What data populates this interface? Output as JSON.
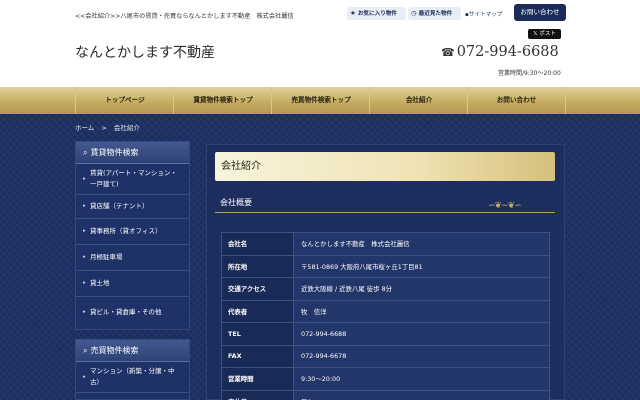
{
  "header": {
    "top_breadcrumb": "<<会社紹介>>八尾市の賃貸・売買ならなんとかします不動産　株式会社麗信",
    "logo_text": "なんとかします不動産",
    "favorites_label": "お気に入り物件",
    "recent_label": "最近見た物件",
    "sitemap_label": "サイトマップ",
    "contact_label": "お問い合わせ",
    "post_label": "ポスト",
    "phone": "072-994-6688",
    "hours": "営業時間/9:30〜20:00"
  },
  "nav": [
    "トップページ",
    "賃貸物件検索トップ",
    "売買物件検索トップ",
    "会社紹介",
    "お問い合わせ"
  ],
  "breadcrumb": {
    "home": "ホーム",
    "sep": ">",
    "current": "会社紹介"
  },
  "sidebar": {
    "rent": {
      "title": "賃貸物件検索",
      "items": [
        "賃貸(アパート・マンション・一戸建て)",
        "貸店舗（テナント）",
        "貸事務所（貸オフィス）",
        "月極駐車場",
        "貸土地",
        "貸ビル・貸倉庫・その他"
      ]
    },
    "sale": {
      "title": "売買物件検索",
      "items": [
        "マンション（新築・分譲・中古）"
      ]
    }
  },
  "main": {
    "title": "会社紹介",
    "section": "会社概要",
    "rows": [
      {
        "k": "会社名",
        "v": "なんとかします不動産　株式会社麗信"
      },
      {
        "k": "所在地",
        "v": "〒581-0869 大阪府八尾市桜ヶ丘1丁目81"
      },
      {
        "k": "交通アクセス",
        "v": "近鉄大阪線 / 近鉄八尾 徒歩 8分"
      },
      {
        "k": "代表者",
        "v": "牧　信洋"
      },
      {
        "k": "TEL",
        "v": "072-994-6688"
      },
      {
        "k": "FAX",
        "v": "072-994-6678"
      },
      {
        "k": "営業時間",
        "v": "9:30〜20:00"
      },
      {
        "k": "定休日",
        "v": "無し"
      }
    ]
  },
  "colors": {
    "navy": "#1b2c5a",
    "gold": "#c6ad62"
  }
}
